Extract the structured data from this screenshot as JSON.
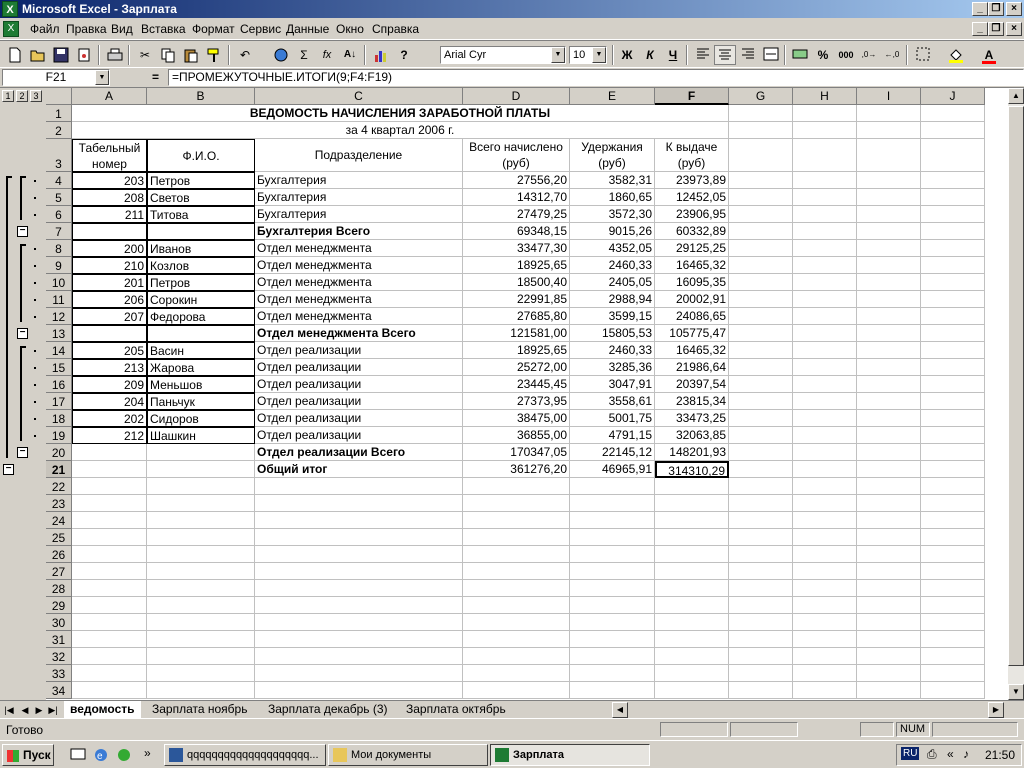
{
  "window": {
    "title": "Microsoft Excel - Зарплата",
    "app_icon": "excel-icon"
  },
  "menu": [
    "Файл",
    "Правка",
    "Вид",
    "Вставка",
    "Формат",
    "Сервис",
    "Данные",
    "Окно",
    "Справка"
  ],
  "toolbar": {
    "font": "Arial Cyr",
    "size": "10",
    "bold": "Ж",
    "italic": "К",
    "underline": "Ч",
    "sum": "Σ",
    "fx": "fx",
    "percent": "%",
    "thousands": "000"
  },
  "formula_bar": {
    "name_box": "F21",
    "eq": "=",
    "formula": "=ПРОМЕЖУТОЧНЫЕ.ИТОГИ(9;F4:F19)"
  },
  "outline_levels": [
    "1",
    "2",
    "3"
  ],
  "columns": [
    "A",
    "B",
    "C",
    "D",
    "E",
    "F",
    "G",
    "H",
    "I",
    "J"
  ],
  "selected_column": "F",
  "selected_row": "21",
  "sheet": {
    "title": "ВЕДОМОСТЬ НАЧИСЛЕНИЯ ЗАРАБОТНОЙ ПЛАТЫ",
    "subtitle": "за 4 квартал 2006 г.",
    "headers": {
      "A": [
        "Табельный",
        "номер"
      ],
      "B": "Ф.И.О.",
      "C": "Подразделение",
      "D": [
        "Всего начислено",
        "(руб)"
      ],
      "E": [
        "Удержания",
        "(руб)"
      ],
      "F": [
        "К выдаче",
        "(руб)"
      ]
    },
    "rows": [
      {
        "row": "4",
        "id": "203",
        "name": "Петров",
        "dept": "Бухгалтерия",
        "total": "27556,20",
        "ded": "3582,31",
        "pay": "23973,89",
        "bold": false
      },
      {
        "row": "5",
        "id": "208",
        "name": "Светов",
        "dept": "Бухгалтерия",
        "total": "14312,70",
        "ded": "1860,65",
        "pay": "12452,05",
        "bold": false
      },
      {
        "row": "6",
        "id": "211",
        "name": "Титова",
        "dept": "Бухгалтерия",
        "total": "27479,25",
        "ded": "3572,30",
        "pay": "23906,95",
        "bold": false
      },
      {
        "row": "7",
        "id": "",
        "name": "",
        "dept": "Бухгалтерия Всего",
        "total": "69348,15",
        "ded": "9015,26",
        "pay": "60332,89",
        "bold": true
      },
      {
        "row": "8",
        "id": "200",
        "name": "Иванов",
        "dept": "Отдел менеджмента",
        "total": "33477,30",
        "ded": "4352,05",
        "pay": "29125,25",
        "bold": false
      },
      {
        "row": "9",
        "id": "210",
        "name": "Козлов",
        "dept": "Отдел менеджмента",
        "total": "18925,65",
        "ded": "2460,33",
        "pay": "16465,32",
        "bold": false
      },
      {
        "row": "10",
        "id": "201",
        "name": "Петров",
        "dept": "Отдел менеджмента",
        "total": "18500,40",
        "ded": "2405,05",
        "pay": "16095,35",
        "bold": false
      },
      {
        "row": "11",
        "id": "206",
        "name": "Сорокин",
        "dept": "Отдел менеджмента",
        "total": "22991,85",
        "ded": "2988,94",
        "pay": "20002,91",
        "bold": false
      },
      {
        "row": "12",
        "id": "207",
        "name": "Федорова",
        "dept": "Отдел менеджмента",
        "total": "27685,80",
        "ded": "3599,15",
        "pay": "24086,65",
        "bold": false
      },
      {
        "row": "13",
        "id": "",
        "name": "",
        "dept": "Отдел менеджмента Всего",
        "total": "121581,00",
        "ded": "15805,53",
        "pay": "105775,47",
        "bold": true
      },
      {
        "row": "14",
        "id": "205",
        "name": "Васин",
        "dept": "Отдел реализации",
        "total": "18925,65",
        "ded": "2460,33",
        "pay": "16465,32",
        "bold": false
      },
      {
        "row": "15",
        "id": "213",
        "name": "Жарова",
        "dept": "Отдел реализации",
        "total": "25272,00",
        "ded": "3285,36",
        "pay": "21986,64",
        "bold": false
      },
      {
        "row": "16",
        "id": "209",
        "name": "Меньшов",
        "dept": "Отдел реализации",
        "total": "23445,45",
        "ded": "3047,91",
        "pay": "20397,54",
        "bold": false
      },
      {
        "row": "17",
        "id": "204",
        "name": "Паньчук",
        "dept": "Отдел реализации",
        "total": "27373,95",
        "ded": "3558,61",
        "pay": "23815,34",
        "bold": false
      },
      {
        "row": "18",
        "id": "202",
        "name": "Сидоров",
        "dept": "Отдел реализации",
        "total": "38475,00",
        "ded": "5001,75",
        "pay": "33473,25",
        "bold": false
      },
      {
        "row": "19",
        "id": "212",
        "name": "Шашкин",
        "dept": "Отдел реализации",
        "total": "36855,00",
        "ded": "4791,15",
        "pay": "32063,85",
        "bold": false
      },
      {
        "row": "20",
        "id": "",
        "name": "",
        "dept": "Отдел реализации Всего",
        "total": "170347,05",
        "ded": "22145,12",
        "pay": "148201,93",
        "bold": true
      },
      {
        "row": "21",
        "id": "",
        "name": "",
        "dept": "Общий итог",
        "total": "361276,20",
        "ded": "46965,91",
        "pay": "314310,29",
        "bold": true
      }
    ],
    "empty_rows": [
      "22",
      "23",
      "24",
      "25",
      "26",
      "27",
      "28",
      "29",
      "30",
      "31",
      "32",
      "33",
      "34"
    ]
  },
  "tabs": [
    {
      "label": "ведомость",
      "active": true
    },
    {
      "label": "Зарплата ноябрь",
      "active": false
    },
    {
      "label": "Зарплата декабрь (3)",
      "active": false
    },
    {
      "label": "Зарплата октябрь",
      "active": false
    }
  ],
  "status": {
    "ready": "Готово",
    "num": "NUM"
  },
  "taskbar": {
    "start": "Пуск",
    "tasks": [
      "qqqqqqqqqqqqqqqqqqqq...",
      "Мои документы",
      "Зарплата"
    ],
    "lang": "RU",
    "clock": "21:50"
  }
}
